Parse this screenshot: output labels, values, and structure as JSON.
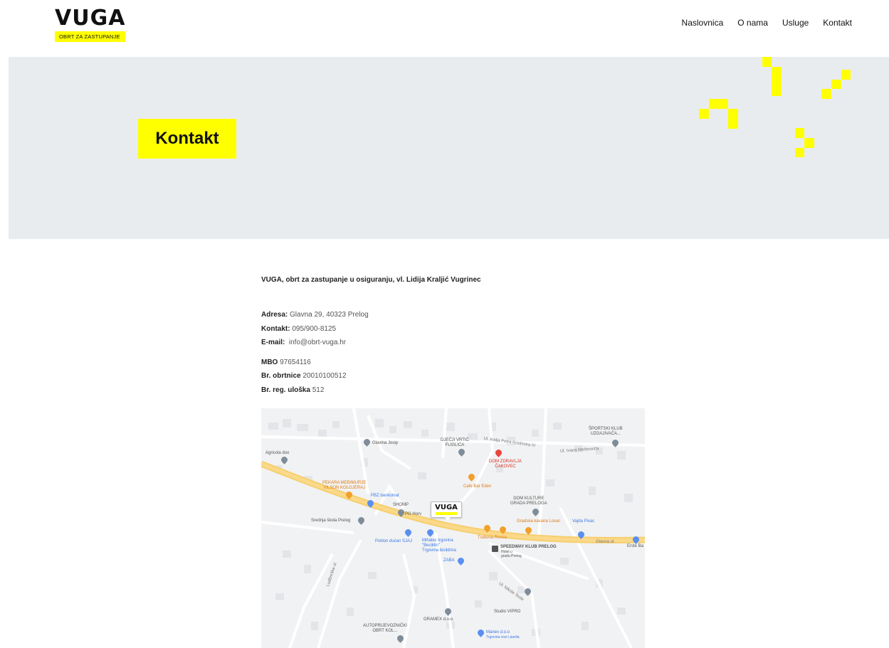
{
  "header": {
    "logo_word": "VUGA",
    "logo_tagline": "OBRT ZA ZASTUPANJE",
    "nav": [
      {
        "label": "Naslovnica",
        "active": false
      },
      {
        "label": "O nama",
        "active": false
      },
      {
        "label": "Usluge",
        "active": false
      },
      {
        "label": "Kontakt",
        "active": true
      }
    ]
  },
  "hero": {
    "title": "Kontakt",
    "background_color": "#e9ecef",
    "accent_color": "#ffff00"
  },
  "contact": {
    "company": "VUGA, obrt za zastupanje u osiguranju, vl. Lidija Kraljić Vugrinec",
    "address_label": "Adresa:",
    "address_value": " Glavna 29, 40323 Prelog",
    "phone_label": "Kontakt:",
    "phone_value": " 095/900-8125",
    "email_label": "E-mail:",
    "email_value": "  info@obrt-vuga.hr",
    "mbo_label": "MBO",
    "mbo_value": " 97654116",
    "obrtnica_label": "Br. obrtnice",
    "obrtnica_value": " 20010100512",
    "reg_label": "Br. reg. uloška",
    "reg_value": " 512"
  },
  "map": {
    "marker_word": "VUGA",
    "labels": {
      "sportski_klub": "ŠPORTSKI KLUB\nUZGAJIVAČA...",
      "djecji_vrtic": "DJEČJI VRTIĆ\nFLIGLICA",
      "glavina_josip": "Glavina Josip",
      "agricola": "Agricola doo",
      "dom_zdravlja": "DOM ZDRAVLJA\nČAKOVEC",
      "cafe_bar_eden": "Cafe Bar Eden",
      "pekara": "PEKARA MEĐIMURJE\nVILSON KOLGJERAJ",
      "pbz": "PBZ bankomat",
      "shomp": "SHOMP",
      "pg_horv": "PG Horv",
      "dom_kulture": "DOM KULTURE\nGRADA PRELOGA",
      "srednja_skola": "Srednja škola Prelog",
      "gradska_kavana": "Gradska kavana Lovac",
      "vajda_pivac": "Vajda Pivac",
      "trattoria": "Trattoria Rossa",
      "poklon_ducan": "Poklon dućan SJAJ",
      "mihalec": "Mihalec trgovina\n\"Beciklin\"\nTrgovina biciklima",
      "speedway": "SPEEDWAY KLUB PRELOG",
      "hotel": "Hotel u\ngradu Prelog",
      "glavna_ul": "Glavna ul.",
      "erste": "Erste Ba",
      "zaba": "ZABA",
      "studio_vipro": "Studio VIPRO",
      "gramex": "GRAMEX d.o.o.",
      "autoprijevoznicki": "AUTOPRIJEVOZNIČKI\nOBRT KOL...",
      "manex": "Manex d.o.o",
      "manex_sub": "Trgovina vozi i pavlia",
      "ludbreska": "Ludbreška ul.",
      "ul_nikole_tesle": "Ul. Nikole Tesle",
      "ul_kralja_petra": "Ul. kralja Petra Krešimira IV",
      "ul_ivana_mestrovica": "Ul. Ivana Meštrovića"
    }
  }
}
